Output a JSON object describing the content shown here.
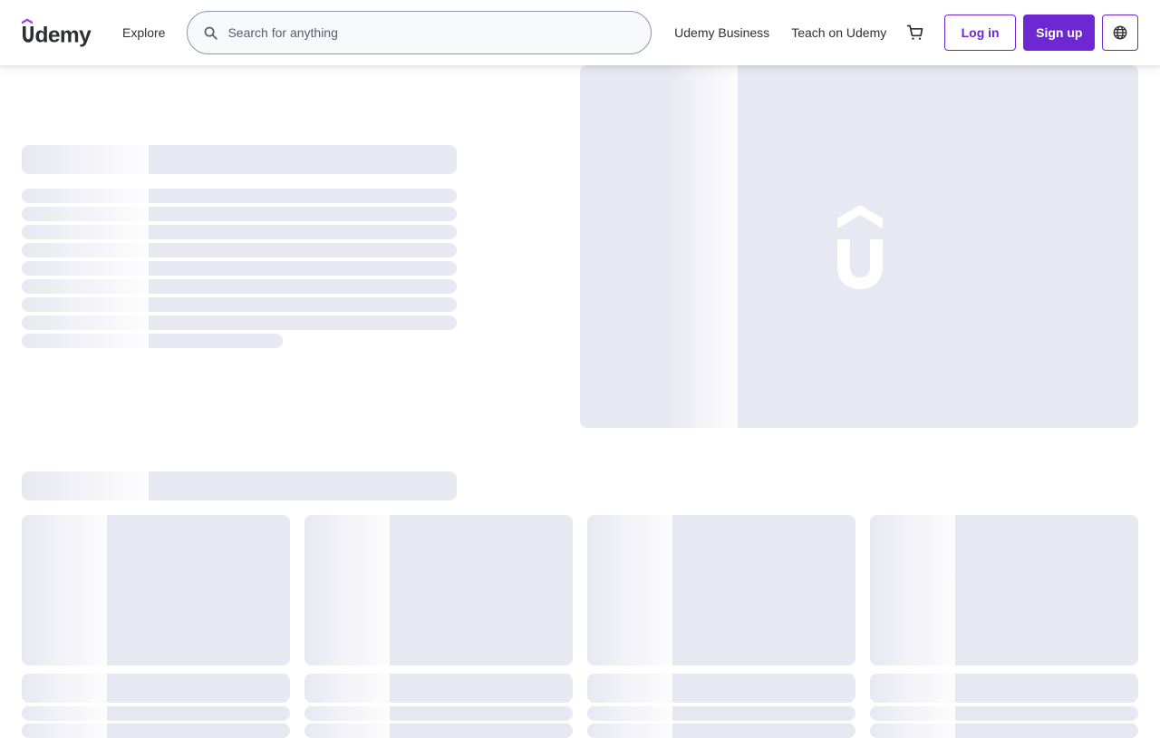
{
  "header": {
    "logo_text": "udemy",
    "explore_label": "Explore",
    "search_placeholder": "Search for anything",
    "search_value": "",
    "business_label": "Udemy Business",
    "teach_label": "Teach on Udemy",
    "login_label": "Log in",
    "signup_label": "Sign up",
    "icons": {
      "search": "search-icon",
      "cart": "shopping-cart-icon",
      "language": "globe-icon"
    }
  },
  "colors": {
    "brand": "#6d28d2",
    "skeleton": "#e8e8f2",
    "text": "#2d2f31"
  },
  "hero": {
    "logo_icon": "udemy-mark-icon"
  }
}
